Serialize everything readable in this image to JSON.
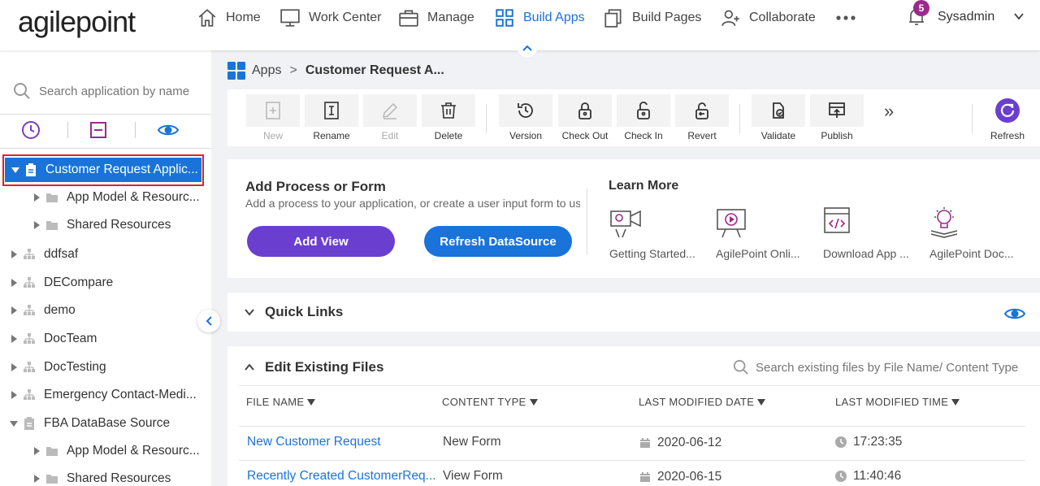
{
  "header": {
    "logo": "agilepoint",
    "nav": [
      {
        "label": "Home",
        "icon": "home-icon"
      },
      {
        "label": "Work Center",
        "icon": "monitor-icon"
      },
      {
        "label": "Manage",
        "icon": "briefcase-icon"
      },
      {
        "label": "Build Apps",
        "icon": "apps-grid-icon"
      },
      {
        "label": "Build Pages",
        "icon": "pages-icon"
      },
      {
        "label": "Collaborate",
        "icon": "collaborate-icon"
      }
    ],
    "notification_count": "5",
    "user_name": "Sysadmin"
  },
  "sidebar": {
    "search_placeholder": "Search application by name",
    "tree": [
      {
        "label": "Customer Request Applic...",
        "level": 0,
        "expanded": true,
        "selected": true
      },
      {
        "label": "App Model & Resourc...",
        "level": 1
      },
      {
        "label": "Shared Resources",
        "level": 1
      },
      {
        "label": "ddfsaf",
        "level": 0
      },
      {
        "label": "DECompare",
        "level": 0
      },
      {
        "label": "demo",
        "level": 0
      },
      {
        "label": "DocTeam",
        "level": 0
      },
      {
        "label": "DocTesting",
        "level": 0
      },
      {
        "label": "Emergency Contact-Medi...",
        "level": 0
      },
      {
        "label": "FBA DataBase Source",
        "level": 0,
        "expanded": true
      },
      {
        "label": "App Model & Resourc...",
        "level": 1
      },
      {
        "label": "Shared Resources",
        "level": 1
      }
    ]
  },
  "breadcrumb": {
    "root": "Apps",
    "separator": ">",
    "current": "Customer Request A..."
  },
  "toolbar": {
    "new": "New",
    "rename": "Rename",
    "edit": "Edit",
    "delete": "Delete",
    "version": "Version",
    "check_out": "Check Out",
    "check_in": "Check In",
    "revert": "Revert",
    "validate": "Validate",
    "publish": "Publish",
    "more": "»",
    "refresh": "Refresh"
  },
  "add_process": {
    "title": "Add Process or Form",
    "description": "Add a process to your application, or create a user input form to use...",
    "add_view": "Add View",
    "refresh_datasource": "Refresh DataSource"
  },
  "learn_more": {
    "title": "Learn More",
    "items": [
      "Getting Started...",
      "AgilePoint Onli...",
      "Download App ...",
      "AgilePoint Doc..."
    ]
  },
  "quick_links": {
    "title": "Quick Links"
  },
  "edit_files": {
    "title": "Edit Existing Files",
    "search_placeholder": "Search existing files by File Name/ Content Type",
    "columns": [
      "FILE NAME",
      "CONTENT TYPE",
      "LAST MODIFIED DATE",
      "LAST MODIFIED TIME"
    ],
    "rows": [
      {
        "name": "New Customer Request",
        "type": "New Form",
        "date": "2020-06-12",
        "time": "17:23:35"
      },
      {
        "name": "Recently Created CustomerReq...",
        "type": "View Form",
        "date": "2020-06-15",
        "time": "11:40:46"
      }
    ]
  },
  "colors": {
    "accent": "#1a73d9",
    "purple": "#6a3fcf",
    "badge": "#9c2a8a",
    "highlight": "#d92626"
  }
}
